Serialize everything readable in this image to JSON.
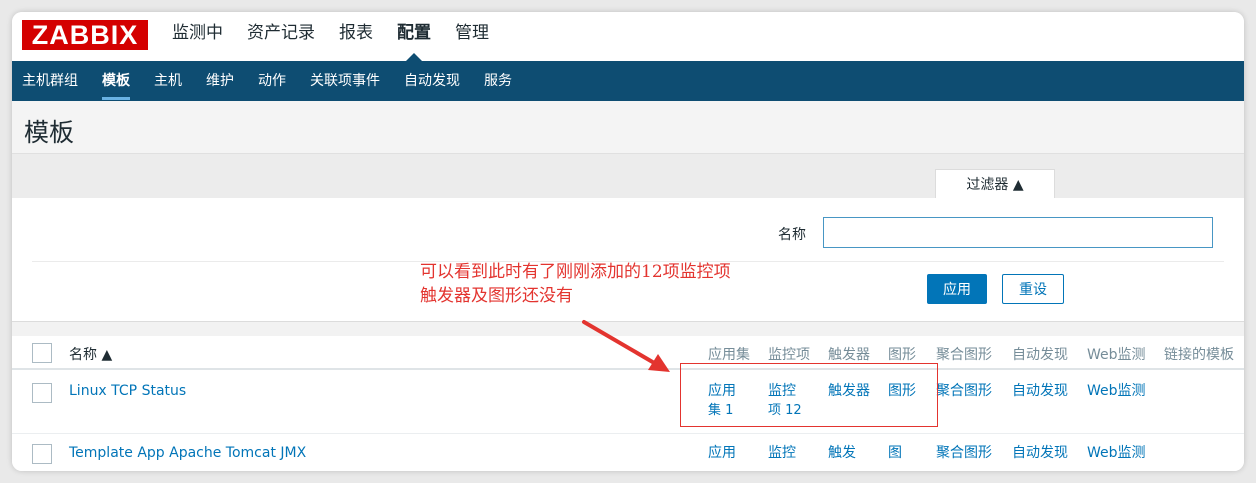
{
  "logo": "ZABBIX",
  "top_menu": [
    {
      "label": "监测中"
    },
    {
      "label": "资产记录"
    },
    {
      "label": "报表"
    },
    {
      "label": "配置"
    },
    {
      "label": "管理"
    }
  ],
  "sub_menu": [
    {
      "label": "主机群组"
    },
    {
      "label": "模板"
    },
    {
      "label": "主机"
    },
    {
      "label": "维护"
    },
    {
      "label": "动作"
    },
    {
      "label": "关联项事件"
    },
    {
      "label": "自动发现"
    },
    {
      "label": "服务"
    }
  ],
  "page_title": "模板",
  "filter": {
    "tab_label": "过滤器 ▲",
    "name_label": "名称",
    "name_value": "",
    "apply_label": "应用",
    "reset_label": "重设"
  },
  "annotation": {
    "line1": "可以看到此时有了刚刚添加的12项监控项",
    "line2": "触发器及图形还没有"
  },
  "table": {
    "headers": {
      "name": "名称 ▲",
      "applications": "应用集",
      "items": "监控项",
      "triggers": "触发器",
      "graphs": "图形",
      "screens": "聚合图形",
      "discovery": "自动发现",
      "web": "Web监测",
      "linked": "链接的模板"
    },
    "rows": [
      {
        "name": "Linux TCP Status",
        "applications_l1": "应用",
        "applications_l2": "集 1",
        "items_l1": "监控",
        "items_l2": "项 12",
        "triggers": "触发器",
        "graphs": "图形",
        "screens": "聚合图形",
        "discovery": "自动发现",
        "web": "Web监测"
      },
      {
        "name": "Template App Apache Tomcat JMX",
        "applications_l1": "应用",
        "items_l1": "监控",
        "triggers": "触发",
        "graphs": "图",
        "screens": "聚合图形",
        "discovery": "自动发现",
        "web": "Web监测"
      }
    ]
  },
  "colors": {
    "logo_red": "#d40000",
    "subnav_blue": "#0e4d72",
    "link_blue": "#0275b8",
    "annotation_red": "#e3342f"
  }
}
